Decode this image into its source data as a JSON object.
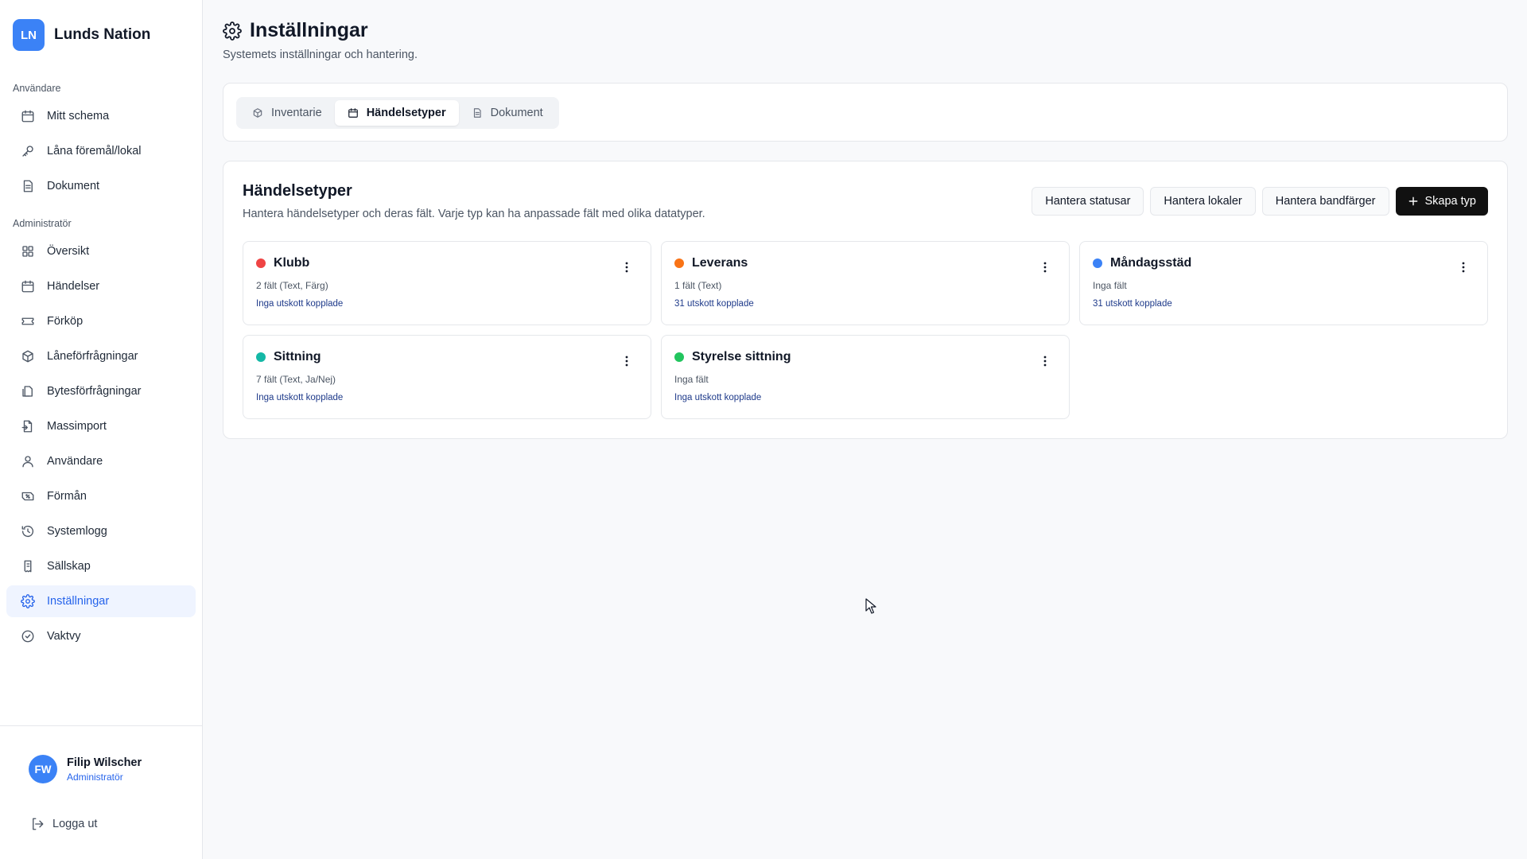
{
  "brand": {
    "logo_text": "LN",
    "name": "Lunds Nation",
    "accent": "#3b82f6"
  },
  "sidebar": {
    "user_section": "Användare",
    "user_items": [
      {
        "label": "Mitt schema",
        "icon": "calendar-icon"
      },
      {
        "label": "Låna föremål/lokal",
        "icon": "key-icon"
      },
      {
        "label": "Dokument",
        "icon": "document-icon"
      }
    ],
    "admin_section": "Administratör",
    "admin_items": [
      {
        "label": "Översikt",
        "icon": "grid-icon"
      },
      {
        "label": "Händelser",
        "icon": "calendar-icon"
      },
      {
        "label": "Förköp",
        "icon": "ticket-icon"
      },
      {
        "label": "Låneförfrågningar",
        "icon": "package-icon"
      },
      {
        "label": "Bytesförfrågningar",
        "icon": "swap-icon"
      },
      {
        "label": "Massimport",
        "icon": "import-icon"
      },
      {
        "label": "Användare",
        "icon": "user-icon"
      },
      {
        "label": "Förmån",
        "icon": "ticket-percent-icon"
      },
      {
        "label": "Systemlogg",
        "icon": "history-icon"
      },
      {
        "label": "Sällskap",
        "icon": "receipt-icon"
      },
      {
        "label": "Inställningar",
        "icon": "gear-icon",
        "active": true
      },
      {
        "label": "Vaktvy",
        "icon": "shield-check-icon"
      }
    ],
    "user": {
      "initials": "FW",
      "name": "Filip Wilscher",
      "role": "Administratör"
    },
    "logout_label": "Logga ut"
  },
  "page": {
    "title": "Inställningar",
    "subtitle": "Systemets inställningar och hantering."
  },
  "tabs": [
    {
      "label": "Inventarie",
      "icon": "box-icon"
    },
    {
      "label": "Händelsetyper",
      "icon": "calendar-icon",
      "active": true
    },
    {
      "label": "Dokument",
      "icon": "document-icon"
    }
  ],
  "event_types": {
    "title": "Händelsetyper",
    "description": "Hantera händelsetyper och deras fält. Varje typ kan ha anpassade fält med olika datatyper.",
    "buttons": {
      "manage_statuses": "Hantera statusar",
      "manage_venues": "Hantera lokaler",
      "manage_band_colors": "Hantera bandfärger",
      "create_type": "Skapa typ"
    },
    "types": [
      {
        "name": "Klubb",
        "color": "#ef4444",
        "fields": "2 fält (Text, Färg)",
        "outputs": "Inga utskott kopplade"
      },
      {
        "name": "Leverans",
        "color": "#f97316",
        "fields": "1 fält (Text)",
        "outputs": "31 utskott kopplade"
      },
      {
        "name": "Måndagsstäd",
        "color": "#3b82f6",
        "fields": "Inga fält",
        "outputs": "31 utskott kopplade"
      },
      {
        "name": "Sittning",
        "color": "#14b8a6",
        "fields": "7 fält (Text, Ja/Nej)",
        "outputs": "Inga utskott kopplade"
      },
      {
        "name": "Styrelse sittning",
        "color": "#22c55e",
        "fields": "Inga fält",
        "outputs": "Inga utskott kopplade"
      }
    ]
  }
}
